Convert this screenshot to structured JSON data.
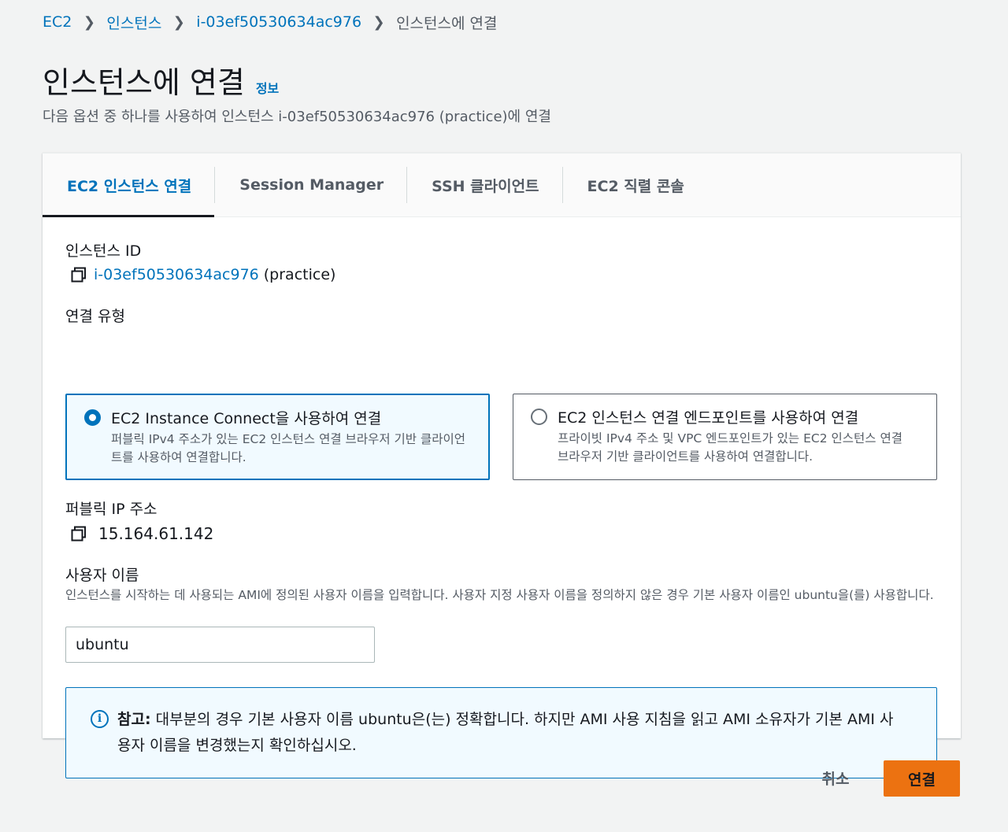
{
  "breadcrumb": {
    "items": [
      "EC2",
      "인스턴스",
      "i-03ef50530634ac976"
    ],
    "current": "인스턴스에 연결"
  },
  "header": {
    "title": "인스턴스에 연결",
    "info_link": "정보",
    "subtitle": "다음 옵션 중 하나를 사용하여 인스턴스 i-03ef50530634ac976 (practice)에 연결"
  },
  "tabs": [
    {
      "label": "EC2 인스턴스 연결",
      "active": true
    },
    {
      "label": "Session Manager",
      "active": false
    },
    {
      "label": "SSH 클라이언트",
      "active": false
    },
    {
      "label": "EC2 직렬 콘솔",
      "active": false
    }
  ],
  "instance": {
    "label": "인스턴스 ID",
    "id": "i-03ef50530634ac976",
    "name_suffix": "(practice)"
  },
  "connection_type": {
    "label": "연결 유형",
    "options": [
      {
        "title": "EC2 Instance Connect을 사용하여 연결",
        "description": "퍼블릭 IPv4 주소가 있는 EC2 인스턴스 연결 브라우저 기반 클라이언트를 사용하여 연결합니다.",
        "selected": true
      },
      {
        "title": "EC2 인스턴스 연결 엔드포인트를 사용하여 연결",
        "description": "프라이빗 IPv4 주소 및 VPC 엔드포인트가 있는 EC2 인스턴스 연결 브라우저 기반 클라이언트를 사용하여 연결합니다.",
        "selected": false
      }
    ]
  },
  "public_ip": {
    "label": "퍼블릭 IP 주소",
    "value": "15.164.61.142"
  },
  "username": {
    "label": "사용자 이름",
    "help": "인스턴스를 시작하는 데 사용되는 AMI에 정의된 사용자 이름을 입력합니다. 사용자 지정 사용자 이름을 정의하지 않은 경우 기본 사용자 이름인 ubuntu을(를) 사용합니다.",
    "value": "ubuntu"
  },
  "alert": {
    "icon": "info-icon",
    "bold": "참고:",
    "text": "대부분의 경우 기본 사용자 이름 ubuntu은(는) 정확합니다. 하지만 AMI 사용 지침을 읽고 AMI 소유자가 기본 AMI 사용자 이름을 변경했는지 확인하십시오."
  },
  "actions": {
    "cancel": "취소",
    "connect": "연결"
  },
  "colors": {
    "accent": "#0073bb",
    "primary_button": "#ec7211",
    "background": "#f2f3f3"
  }
}
